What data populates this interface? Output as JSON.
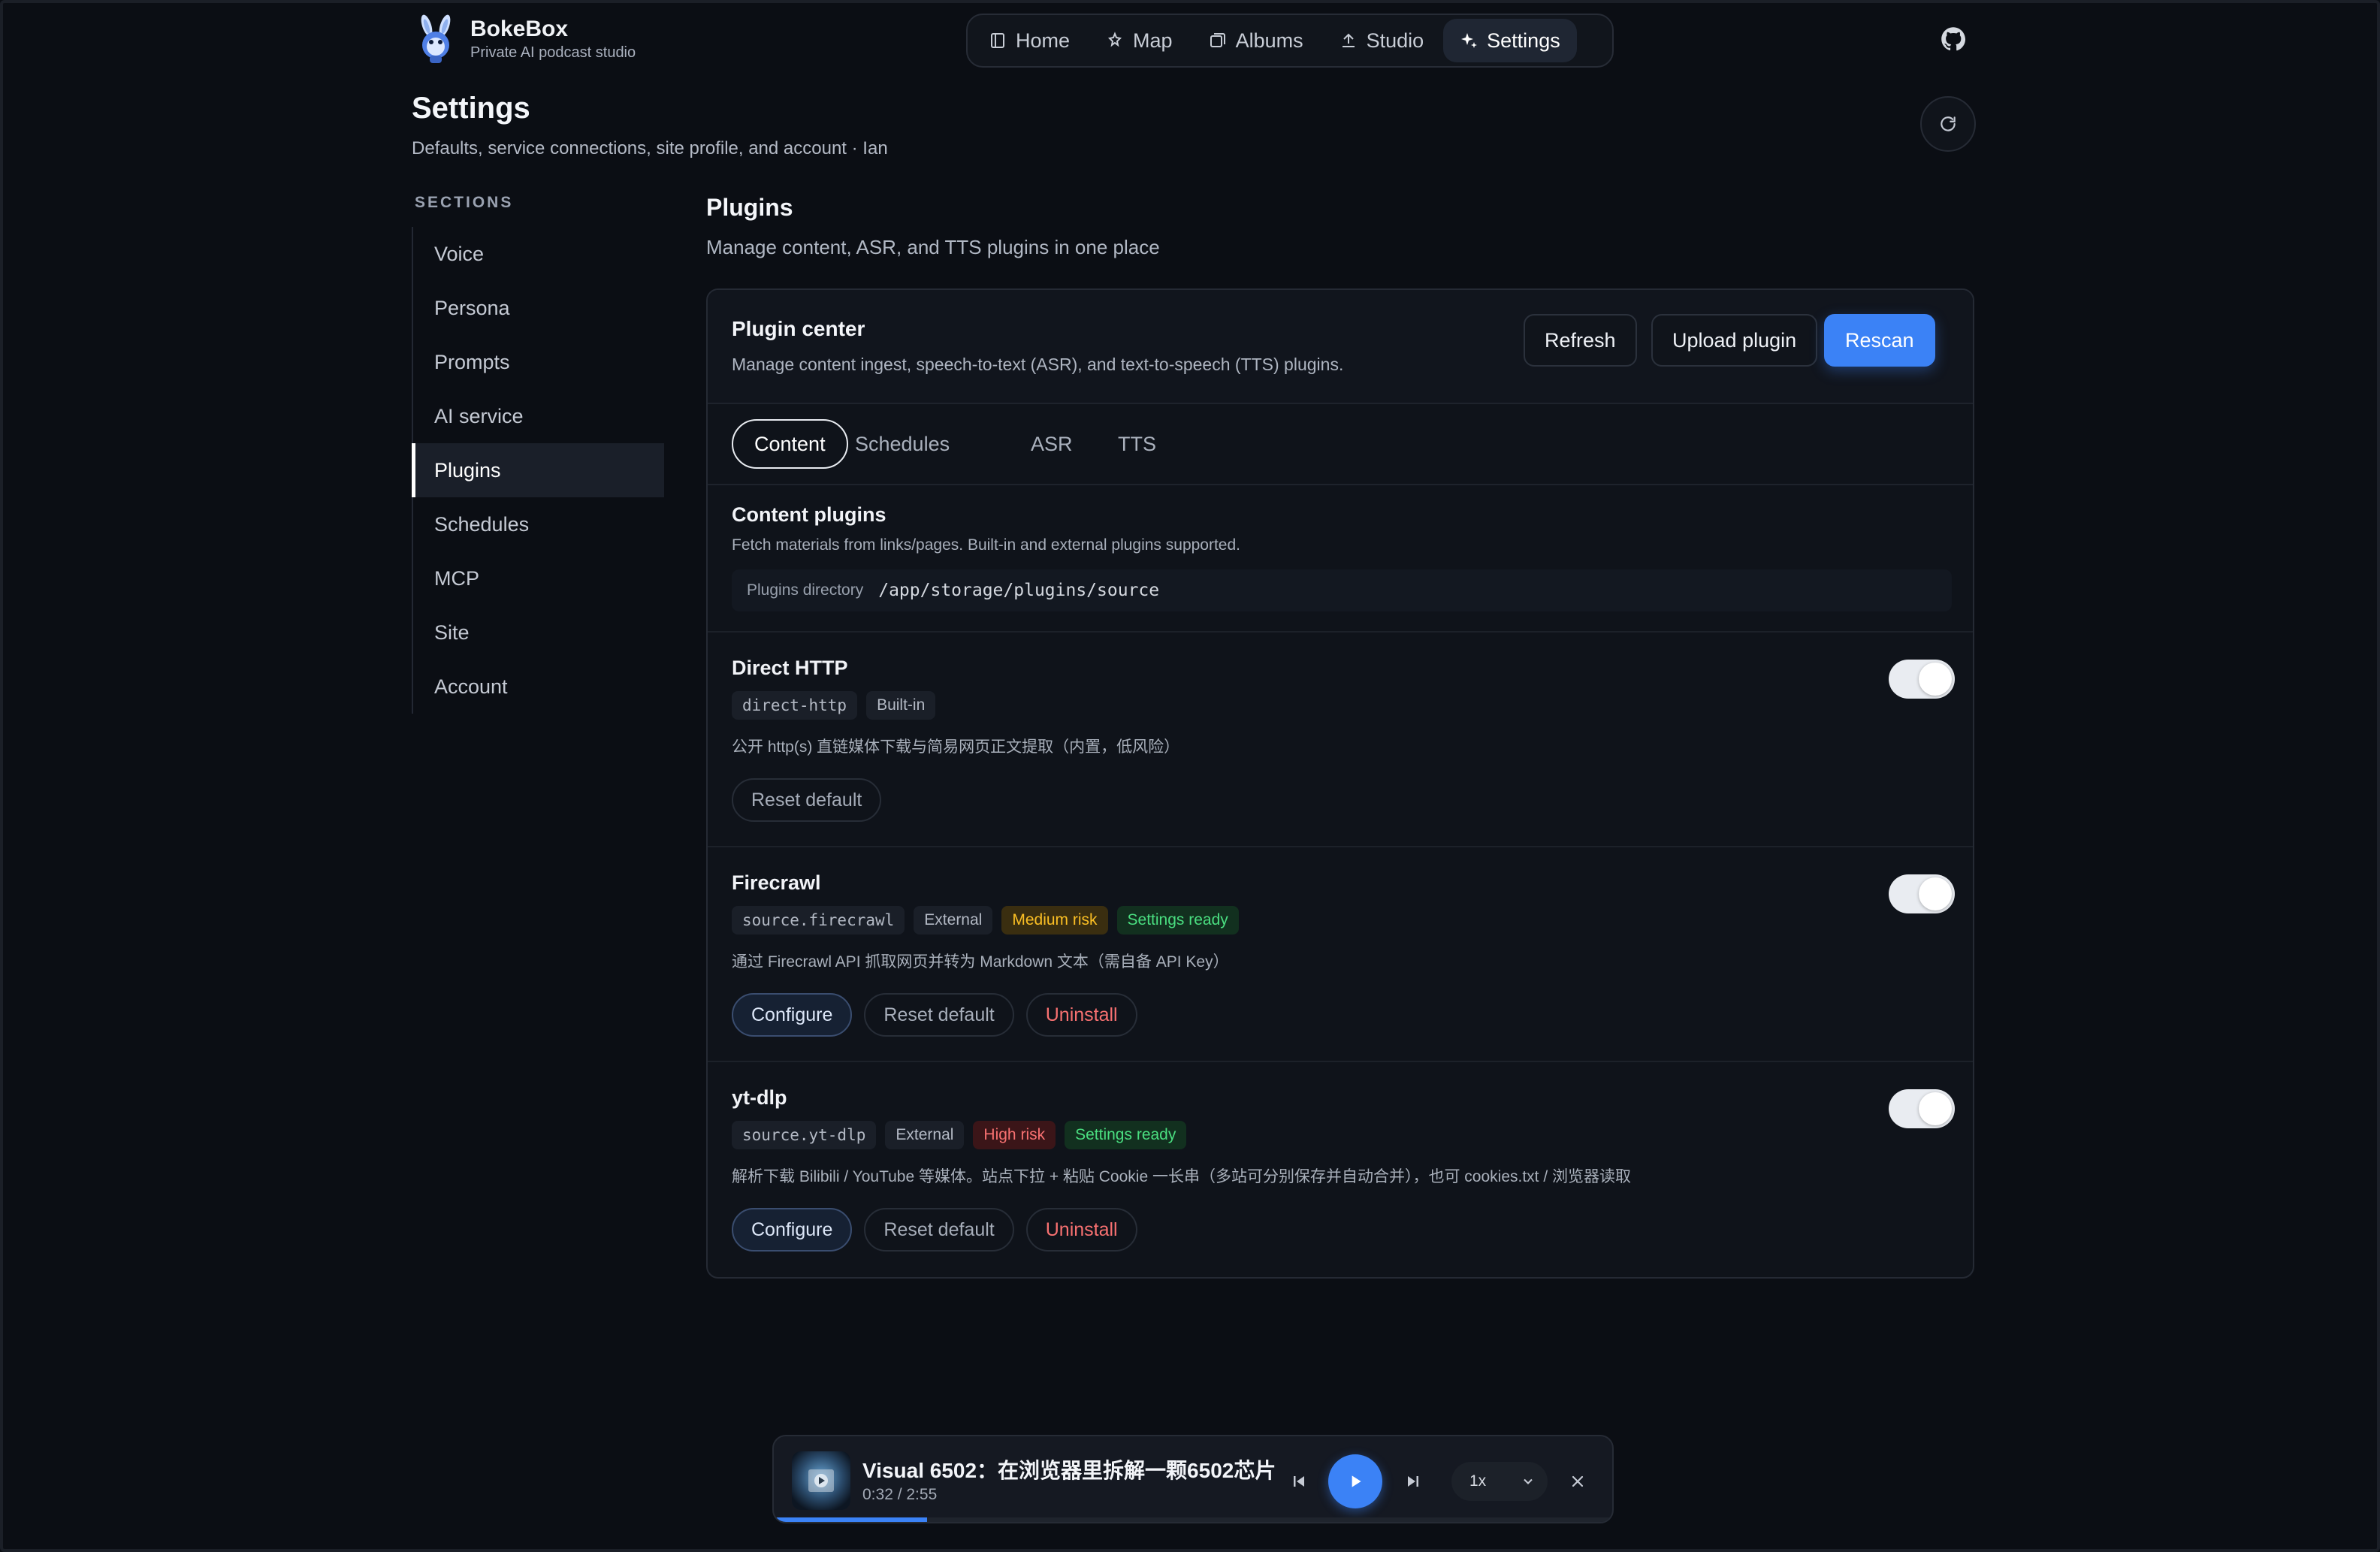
{
  "brand": {
    "name": "BokeBox",
    "tagline": "Private AI podcast studio"
  },
  "nav": {
    "items": [
      {
        "label": "Home",
        "icon": "home-icon"
      },
      {
        "label": "Map",
        "icon": "map-icon"
      },
      {
        "label": "Albums",
        "icon": "albums-icon"
      },
      {
        "label": "Studio",
        "icon": "upload-icon"
      },
      {
        "label": "Settings",
        "icon": "sparkle-icon",
        "active": true
      }
    ]
  },
  "page": {
    "title": "Settings",
    "subtitle": "Defaults, service connections, site profile, and account · Ian"
  },
  "sidebar": {
    "label": "SECTIONS",
    "items": [
      {
        "label": "Voice"
      },
      {
        "label": "Persona"
      },
      {
        "label": "Prompts"
      },
      {
        "label": "AI service"
      },
      {
        "label": "Plugins",
        "active": true
      },
      {
        "label": "Schedules"
      },
      {
        "label": "MCP"
      },
      {
        "label": "Site"
      },
      {
        "label": "Account"
      }
    ]
  },
  "main": {
    "title": "Plugins",
    "subtitle": "Manage content, ASR, and TTS plugins in one place"
  },
  "plugin_center": {
    "title": "Plugin center",
    "description": "Manage content ingest, speech-to-text (ASR), and text-to-speech (TTS) plugins.",
    "buttons": {
      "refresh": "Refresh",
      "upload": "Upload plugin",
      "rescan": "Rescan"
    },
    "tabs": [
      {
        "label": "Content",
        "active": true
      },
      {
        "label": "Schedules"
      },
      {
        "label": "ASR"
      },
      {
        "label": "TTS"
      }
    ]
  },
  "content_plugins": {
    "title": "Content plugins",
    "description": "Fetch materials from links/pages. Built-in and external plugins supported.",
    "dir_label": "Plugins directory",
    "dir_path": "/app/storage/plugins/source"
  },
  "plugins": [
    {
      "name": "Direct HTTP",
      "id": "direct-http",
      "kind": "Built-in",
      "description": "公开 http(s) 直链媒体下载与简易网页正文提取（内置，低风险）",
      "enabled": true,
      "actions": {
        "reset": "Reset default"
      }
    },
    {
      "name": "Firecrawl",
      "id": "source.firecrawl",
      "kind": "External",
      "risk": "Medium risk",
      "status": "Settings ready",
      "description": "通过 Firecrawl API 抓取网页并转为 Markdown 文本（需自备 API Key）",
      "enabled": true,
      "actions": {
        "configure": "Configure",
        "reset": "Reset default",
        "uninstall": "Uninstall"
      }
    },
    {
      "name": "yt-dlp",
      "id": "source.yt-dlp",
      "kind": "External",
      "risk": "High risk",
      "status": "Settings ready",
      "description": "解析下载 Bilibili / YouTube 等媒体。站点下拉 + 粘贴 Cookie 一长串（多站可分别保存并自动合并），也可 cookies.txt / 浏览器读取",
      "enabled": true,
      "actions": {
        "configure": "Configure",
        "reset": "Reset default",
        "uninstall": "Uninstall"
      }
    }
  ],
  "player": {
    "title": "Visual 6502：在浏览器里拆解一颗6502芯片",
    "time": "0:32 / 2:55",
    "speed": "1x",
    "progress": 0.183
  },
  "colors": {
    "accent": "#3b82f6",
    "background": "#0b0e14"
  }
}
